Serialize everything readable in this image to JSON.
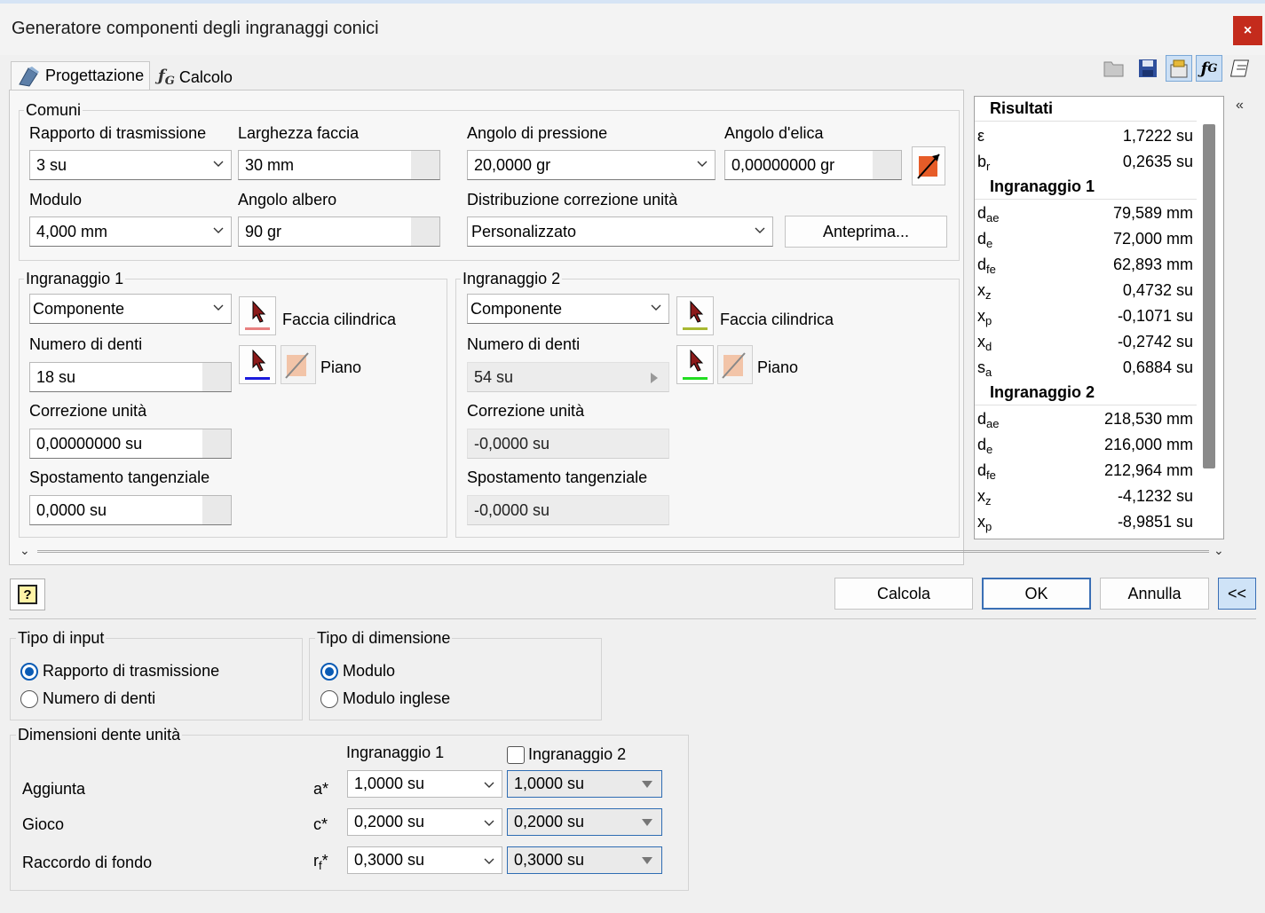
{
  "window": {
    "title": "Generatore componenti degli ingranaggi conici",
    "close": "×"
  },
  "tabs": [
    {
      "label": "Progettazione"
    },
    {
      "label": "Calcolo"
    }
  ],
  "comuni": {
    "label": "Comuni",
    "rapporto": {
      "label": "Rapporto di trasmissione",
      "value": "3 su"
    },
    "larghezza": {
      "label": "Larghezza faccia",
      "value": "30 mm"
    },
    "pressione": {
      "label": "Angolo di pressione",
      "value": "20,0000 gr"
    },
    "elica": {
      "label": "Angolo d'elica",
      "value": "0,00000000 gr"
    },
    "modulo": {
      "label": "Modulo",
      "value": "4,000 mm"
    },
    "albero": {
      "label": "Angolo albero",
      "value": "90 gr"
    },
    "distribuzione": {
      "label": "Distribuzione correzione unità",
      "value": "Personalizzato"
    },
    "anteprima": "Anteprima..."
  },
  "gear1": {
    "label": "Ingranaggio 1",
    "type": "Componente",
    "face": "Faccia cilindrica",
    "plane": "Piano",
    "teeth_label": "Numero di denti",
    "teeth": "18 su",
    "corr_label": "Correzione unità",
    "corr": "0,00000000 su",
    "shift_label": "Spostamento tangenziale",
    "shift": "0,0000 su"
  },
  "gear2": {
    "label": "Ingranaggio 2",
    "type": "Componente",
    "face": "Faccia cilindrica",
    "plane": "Piano",
    "teeth_label": "Numero di denti",
    "teeth": "54 su",
    "corr_label": "Correzione unità",
    "corr": "-0,0000 su",
    "shift_label": "Spostamento tangenziale",
    "shift": "-0,0000 su"
  },
  "results": {
    "title": "Risultati",
    "general": [
      {
        "sym": "ε",
        "sub": "",
        "val": "1,7222 su"
      },
      {
        "sym": "b",
        "sub": "r",
        "val": "0,2635 su"
      }
    ],
    "g1_title": "Ingranaggio 1",
    "g1": [
      {
        "sym": "d",
        "sub": "ae",
        "val": "79,589 mm"
      },
      {
        "sym": "d",
        "sub": "e",
        "val": "72,000 mm"
      },
      {
        "sym": "d",
        "sub": "fe",
        "val": "62,893 mm"
      },
      {
        "sym": "x",
        "sub": "z",
        "val": "0,4732 su"
      },
      {
        "sym": "x",
        "sub": "p",
        "val": "-0,1071 su"
      },
      {
        "sym": "x",
        "sub": "d",
        "val": "-0,2742 su"
      },
      {
        "sym": "s",
        "sub": "a",
        "val": "0,6884 su"
      }
    ],
    "g2_title": "Ingranaggio 2",
    "g2": [
      {
        "sym": "d",
        "sub": "ae",
        "val": "218,530 mm"
      },
      {
        "sym": "d",
        "sub": "e",
        "val": "216,000 mm"
      },
      {
        "sym": "d",
        "sub": "fe",
        "val": "212,964 mm"
      },
      {
        "sym": "x",
        "sub": "z",
        "val": "-4,1232 su"
      },
      {
        "sym": "x",
        "sub": "p",
        "val": "-8,9851 su"
      }
    ]
  },
  "buttons": {
    "help": "?",
    "calcola": "Calcola",
    "ok": "OK",
    "annulla": "Annulla",
    "collapse": "<<"
  },
  "input_type": {
    "label": "Tipo di input",
    "opt1": "Rapporto di trasmissione",
    "opt2": "Numero di denti"
  },
  "dim_type": {
    "label": "Tipo di dimensione",
    "opt1": "Modulo",
    "opt2": "Modulo inglese"
  },
  "tooth": {
    "label": "Dimensioni dente unità",
    "col1": "Ingranaggio 1",
    "col2": "Ingranaggio 2",
    "rows": [
      {
        "name": "Aggiunta",
        "sym": "a*",
        "sub": "",
        "v1": "1,0000 su",
        "v2": "1,0000 su"
      },
      {
        "name": "Gioco",
        "sym": "c*",
        "sub": "",
        "v1": "0,2000 su",
        "v2": "0,2000 su"
      },
      {
        "name": "Raccordo di fondo",
        "sym": "r",
        "sub": "f",
        "sym2": "*",
        "v1": "0,3000 su",
        "v2": "0,3000 su"
      }
    ]
  }
}
